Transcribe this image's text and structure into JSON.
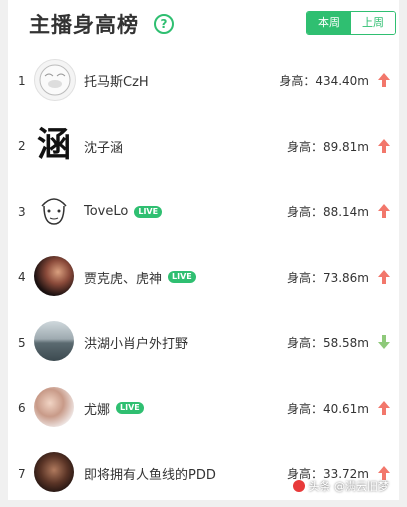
{
  "header": {
    "title": "主播身高榜",
    "help_icon": "question-circle-icon",
    "tabs": [
      {
        "label": "本周",
        "active": true
      },
      {
        "label": "上周",
        "active": false
      }
    ]
  },
  "rows": [
    {
      "rank": "1",
      "name": "托马斯CzH",
      "live": false,
      "height": "身高：434.40m",
      "trend": "up",
      "avatar_text": "",
      "avatar_icon": "sketch-face-avatar"
    },
    {
      "rank": "2",
      "name": "沈子涵",
      "live": false,
      "height": "身高：89.81m",
      "trend": "up",
      "avatar_text": "涵",
      "avatar_icon": "calligraphy-avatar"
    },
    {
      "rank": "3",
      "name": "ToveLo",
      "live": true,
      "height": "身高：88.14m",
      "trend": "up",
      "avatar_text": "",
      "avatar_icon": "cartoon-face-avatar"
    },
    {
      "rank": "4",
      "name": "贾克虎、虎神",
      "live": true,
      "height": "身高：73.86m",
      "trend": "up",
      "avatar_text": "",
      "avatar_icon": "photo-avatar"
    },
    {
      "rank": "5",
      "name": "洪湖小肖户外打野",
      "live": false,
      "height": "身高：58.58m",
      "trend": "down",
      "avatar_text": "",
      "avatar_icon": "landscape-avatar"
    },
    {
      "rank": "6",
      "name": "尤娜",
      "live": true,
      "height": "身高：40.61m",
      "trend": "up",
      "avatar_text": "",
      "avatar_icon": "photo-avatar"
    },
    {
      "rank": "7",
      "name": "即将拥有人鱼线的PDD",
      "live": false,
      "height": "身高：33.72m",
      "trend": "up",
      "avatar_text": "",
      "avatar_icon": "photo-avatar"
    }
  ],
  "live_badge": "LIVE",
  "watermark": "头条 @满云旧梦",
  "colors": {
    "accent": "#2fbf71",
    "up": "#f2776b",
    "down": "#8ec97a"
  }
}
